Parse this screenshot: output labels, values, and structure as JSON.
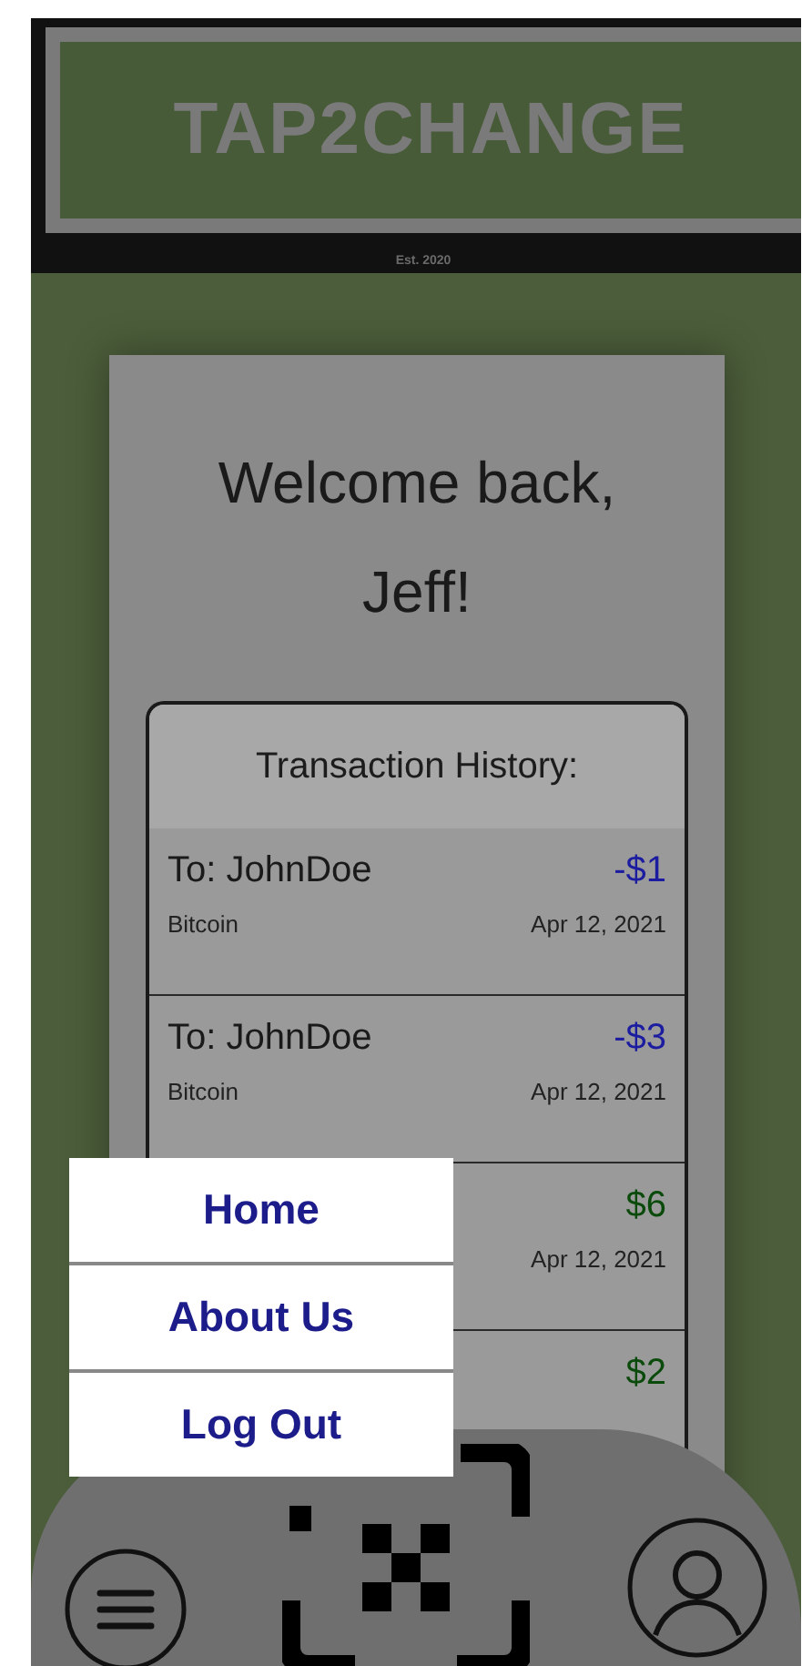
{
  "header": {
    "logo": "TAP2CHANGE",
    "tagline": "Est. 2020"
  },
  "welcome": {
    "lines": [
      "Welcome back,",
      "Jeff!"
    ]
  },
  "history": {
    "title": "Transaction History:",
    "rows": [
      {
        "recipient": "To: JohnDoe",
        "amount": "-$1",
        "color": "#1c1ca0",
        "currency": "Bitcoin",
        "date": "Apr 12, 2021"
      },
      {
        "recipient": "To: JohnDoe",
        "amount": "-$3",
        "color": "#1c1ca0",
        "currency": "Bitcoin",
        "date": "Apr 12, 2021"
      },
      {
        "amount": "$6",
        "color": "#0a4a0a",
        "date": "Apr 12, 2021"
      },
      {
        "amount": "$2",
        "color": "#0a4a0a"
      }
    ]
  },
  "menu": {
    "items": [
      {
        "label": "Home"
      },
      {
        "label": "About Us"
      },
      {
        "label": "Log Out"
      }
    ]
  }
}
